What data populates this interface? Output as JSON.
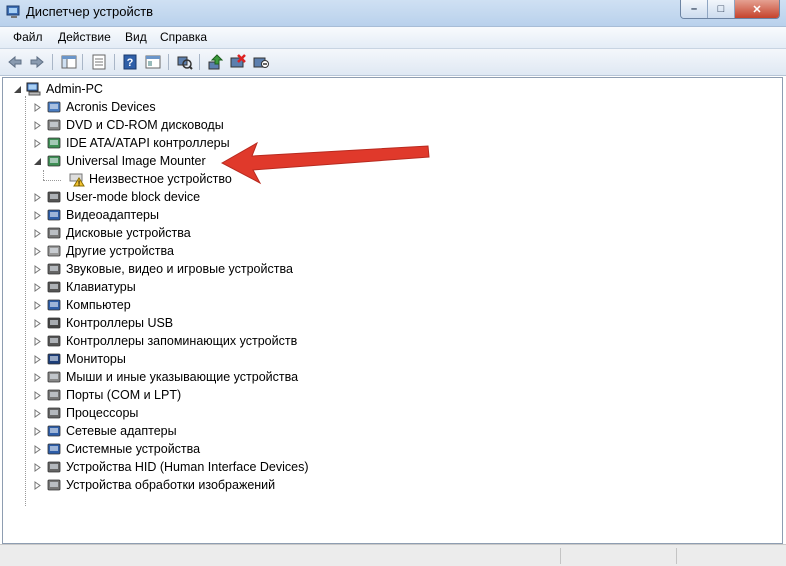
{
  "window": {
    "title": "Диспетчер устройств",
    "controls": {
      "minimize": "–",
      "maximize": "□",
      "close": "✕"
    }
  },
  "menu": [
    "Файл",
    "Действие",
    "Вид",
    "Справка"
  ],
  "toolbar": [
    "back-icon",
    "forward-icon",
    "show-hide-tree-icon",
    "properties-icon",
    "help-icon",
    "action-view-icon",
    "scan-hardware-icon",
    "update-driver-icon",
    "disable-device-icon",
    "uninstall-device-icon"
  ],
  "tree": {
    "root": "Admin-PC",
    "items": [
      {
        "label": "Acronis Devices",
        "icon": "acronis-icon"
      },
      {
        "label": "DVD и CD-ROM дисководы",
        "icon": "dvd-drive-icon"
      },
      {
        "label": "IDE ATA/ATAPI контроллеры",
        "icon": "ide-controller-icon"
      },
      {
        "label": "Universal Image Mounter",
        "icon": "image-mounter-icon",
        "expanded": true
      },
      {
        "label": "Неизвестное устройство",
        "icon": "warning-device-icon",
        "child": true
      },
      {
        "label": "User-mode block device",
        "icon": "block-device-icon"
      },
      {
        "label": "Видеоадаптеры",
        "icon": "display-adapter-icon"
      },
      {
        "label": "Дисковые устройства",
        "icon": "disk-drive-icon"
      },
      {
        "label": "Другие устройства",
        "icon": "other-devices-icon"
      },
      {
        "label": "Звуковые, видео и игровые устройства",
        "icon": "sound-icon"
      },
      {
        "label": "Клавиатуры",
        "icon": "keyboard-icon"
      },
      {
        "label": "Компьютер",
        "icon": "computer-icon"
      },
      {
        "label": "Контроллеры USB",
        "icon": "usb-icon"
      },
      {
        "label": "Контроллеры запоминающих устройств",
        "icon": "storage-controller-icon"
      },
      {
        "label": "Мониторы",
        "icon": "monitor-icon"
      },
      {
        "label": "Мыши и иные указывающие устройства",
        "icon": "mouse-icon"
      },
      {
        "label": "Порты (COM и LPT)",
        "icon": "port-icon"
      },
      {
        "label": "Процессоры",
        "icon": "processor-icon"
      },
      {
        "label": "Сетевые адаптеры",
        "icon": "network-adapter-icon"
      },
      {
        "label": "Системные устройства",
        "icon": "system-devices-icon"
      },
      {
        "label": "Устройства HID (Human Interface Devices)",
        "icon": "hid-icon"
      },
      {
        "label": "Устройства обработки изображений",
        "icon": "imaging-devices-icon"
      }
    ]
  },
  "annotation": {
    "color": "#e0392b",
    "icon": "red-arrow-icon"
  }
}
